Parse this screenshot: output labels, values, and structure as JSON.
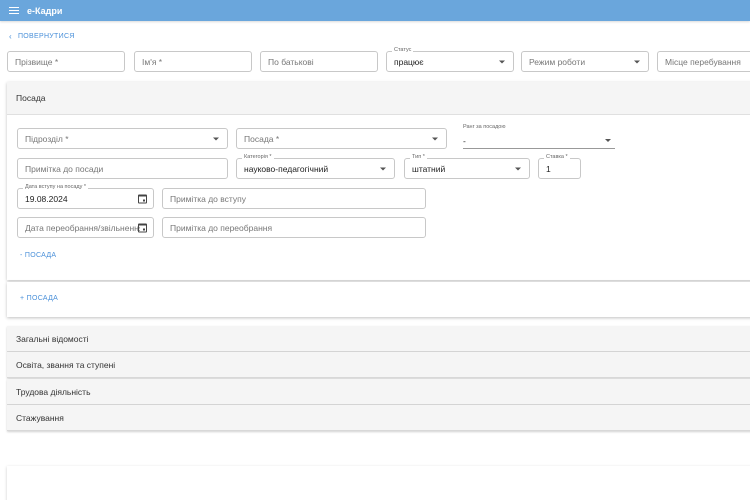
{
  "app": {
    "title": "e-Кадри"
  },
  "nav": {
    "back_label": "ПОВЕРНУТИСЯ"
  },
  "person": {
    "surname_placeholder": "Прізвище *",
    "name_placeholder": "Ім'я *",
    "patronymic_placeholder": "По батькові",
    "status_label": "Статус",
    "status_value": "працює",
    "work_mode_placeholder": "Режим роботи",
    "location_placeholder": "Місце перебування"
  },
  "position": {
    "header": "Посада",
    "department_placeholder": "Підрозділ *",
    "position_placeholder": "Посада *",
    "rank_label": "Ранг за посадою",
    "rank_value": "-",
    "note_placeholder": "Примітка до посади",
    "category_label": "Категорія *",
    "category_value": "науково-педагогічний",
    "type_label": "Тип *",
    "type_value": "штатний",
    "rate_label": "Ставка *",
    "rate_value": "1",
    "entry_date_label": "Дата вступу на посаду *",
    "entry_date_value": "19.08.2024",
    "entry_note_placeholder": "Примітка до вступу",
    "reelection_date_placeholder": "Дата переобрання/звільнення",
    "reelection_note_placeholder": "Примітка до переобрання",
    "remove_label": "- ПОСАДА",
    "add_label": "+ ПОСАДА"
  },
  "sections": [
    {
      "label": "Загальні відомості"
    },
    {
      "label": "Освіта, звання та ступені"
    },
    {
      "label": "Трудова діяльність"
    },
    {
      "label": "Стажування"
    }
  ],
  "colors": {
    "appbar": "#6aa6dc",
    "link": "#4a90d9"
  }
}
